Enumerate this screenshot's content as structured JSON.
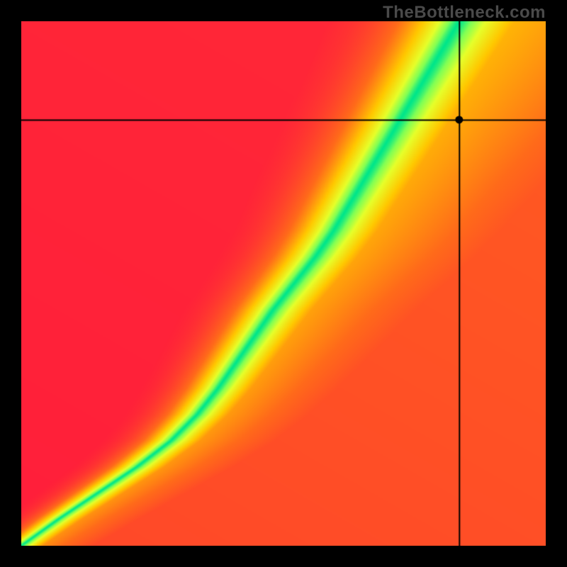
{
  "watermark": "TheBottleneck.com",
  "chart_data": {
    "type": "heatmap",
    "title": "",
    "xlabel": "",
    "ylabel": "",
    "xlim": [
      0,
      1
    ],
    "ylim": [
      0,
      1
    ],
    "crosshair": {
      "x": 0.836,
      "y": 0.812
    },
    "marker": {
      "x": 0.836,
      "y": 0.812
    },
    "ridge_curve_x_for_y": [
      [
        0.0,
        0.0
      ],
      [
        0.05,
        0.07
      ],
      [
        0.1,
        0.145
      ],
      [
        0.15,
        0.22
      ],
      [
        0.2,
        0.285
      ],
      [
        0.25,
        0.335
      ],
      [
        0.3,
        0.375
      ],
      [
        0.35,
        0.41
      ],
      [
        0.4,
        0.445
      ],
      [
        0.45,
        0.48
      ],
      [
        0.5,
        0.52
      ],
      [
        0.55,
        0.56
      ],
      [
        0.6,
        0.595
      ],
      [
        0.65,
        0.625
      ],
      [
        0.7,
        0.655
      ],
      [
        0.75,
        0.685
      ],
      [
        0.8,
        0.715
      ],
      [
        0.85,
        0.745
      ],
      [
        0.9,
        0.775
      ],
      [
        0.95,
        0.805
      ],
      [
        1.0,
        0.835
      ]
    ],
    "ridge_halfwidth": 0.045,
    "color_stops": [
      {
        "t": 0.0,
        "color": "#ff1a3c"
      },
      {
        "t": 0.35,
        "color": "#ff6a1a"
      },
      {
        "t": 0.6,
        "color": "#ffc800"
      },
      {
        "t": 0.8,
        "color": "#e6ff2a"
      },
      {
        "t": 0.92,
        "color": "#80ff55"
      },
      {
        "t": 1.0,
        "color": "#00e68a"
      }
    ]
  }
}
